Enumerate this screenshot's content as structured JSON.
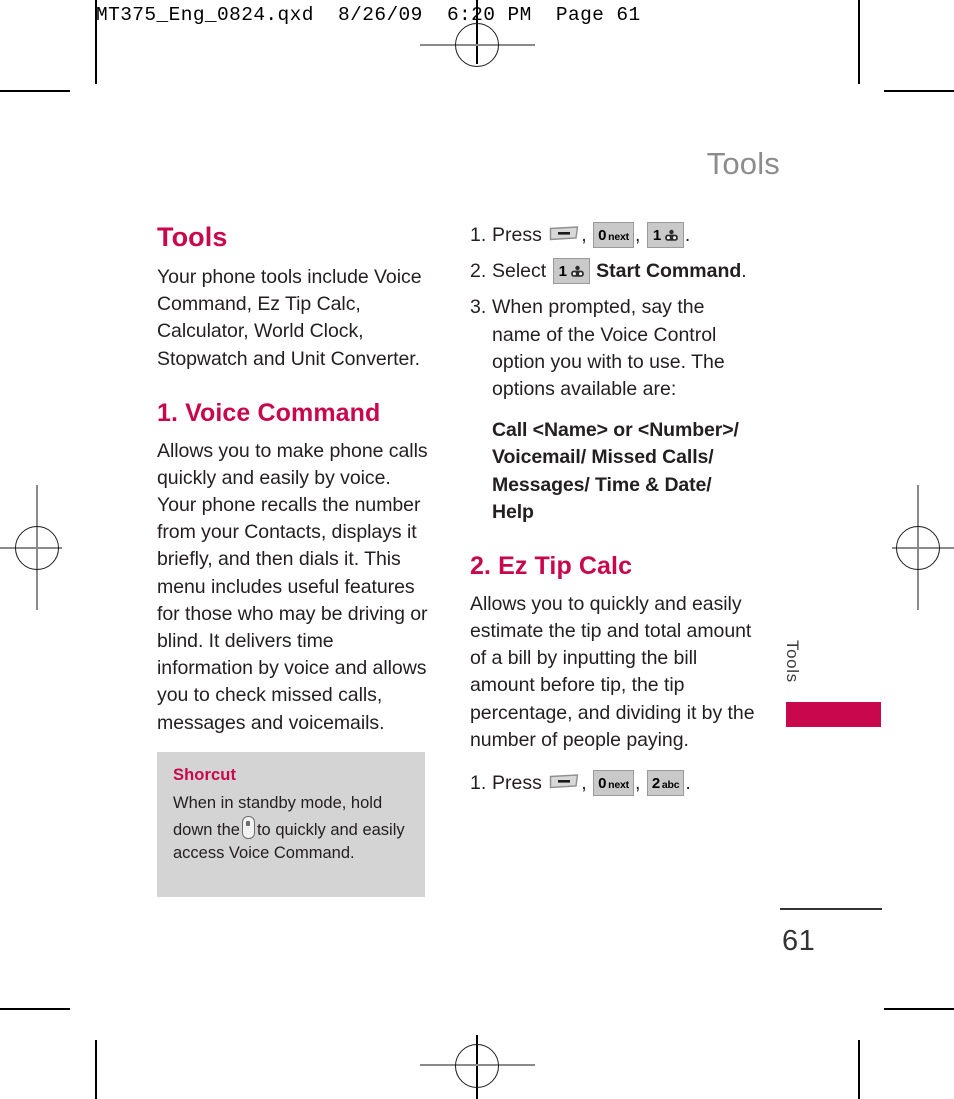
{
  "prepress": {
    "slug": "MT375_Eng_0824.qxd  8/26/09  6:20 PM  Page 61"
  },
  "running_head": "Tools",
  "colors": {
    "accent": "#C8074D",
    "body_text": "#231F20",
    "running_head": "#8C8C8C",
    "callout_bg": "#D4D4D4",
    "key_bg": "#C9C9C9"
  },
  "left_column": {
    "heading": "Tools",
    "intro": "Your phone tools include Voice Command, Ez Tip Calc, Calculator, World Clock, Stopwatch and Unit Converter.",
    "section_heading": "1. Voice Command",
    "section_body": "Allows you to make phone calls quickly and easily by voice. Your phone recalls the number from your Contacts, displays it briefly, and then dials it. This menu includes useful features for those who may be driving or blind. It delivers time information by voice and allows you to check missed calls, messages and voicemails.",
    "shortcut": {
      "title": "Shorcut",
      "text_before_key": "When in standby mode, hold down the",
      "key_icon": "side-key-icon",
      "text_after_key": "to quickly and easily access Voice Command."
    }
  },
  "right_column": {
    "steps": [
      {
        "number": "1.",
        "label": "Press",
        "keys": [
          "soft-key-icon",
          "0 next",
          "1 voicemail"
        ],
        "trailing": "."
      },
      {
        "number": "2.",
        "label": "Select",
        "keys": [
          "1 voicemail"
        ],
        "bold_text": "Start Command",
        "trailing": "."
      },
      {
        "number": "3.",
        "text": "When prompted, say the name of the Voice Control option you with to use. The options available are:"
      }
    ],
    "options": "Call <Name> or <Number>/ Voicemail/ Missed Calls/ Messages/ Time & Date/ Help",
    "section_heading": "2. Ez Tip Calc",
    "section_body": "Allows you to quickly and easily estimate the tip and total amount of a bill by inputting the bill amount before tip, the tip percentage, and dividing it by the number of people paying.",
    "final_step": {
      "number": "1.",
      "label": "Press",
      "keys": [
        "soft-key-icon",
        "0 next",
        "2 abc"
      ],
      "trailing": "."
    }
  },
  "keys": {
    "zero": {
      "digit": "0",
      "sub": "next"
    },
    "one": {
      "digit": "1",
      "sub": "voicemail-icon"
    },
    "two": {
      "digit": "2",
      "sub": "abc"
    }
  },
  "side_tab": {
    "label": "Tools"
  },
  "folio": {
    "page_number": "61"
  }
}
